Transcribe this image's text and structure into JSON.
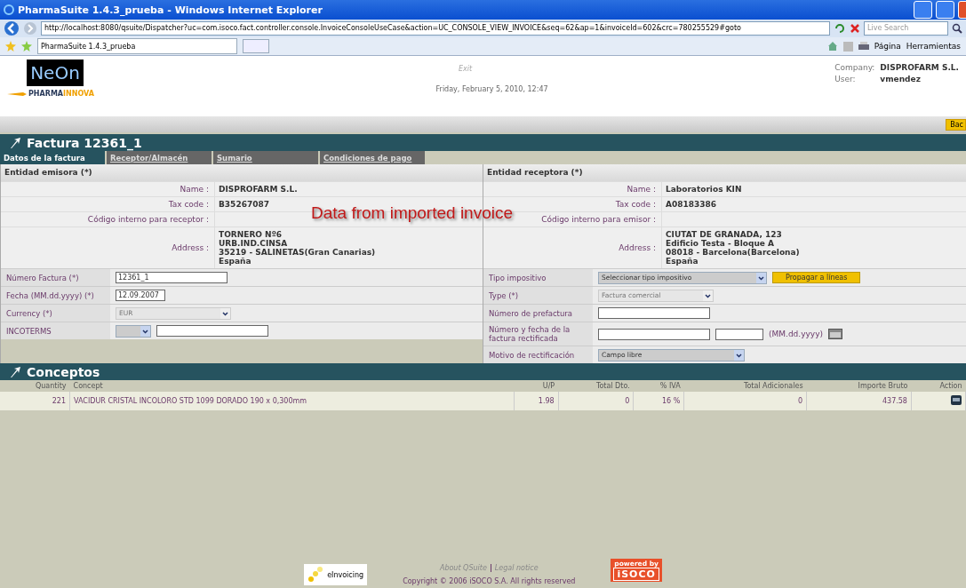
{
  "browser": {
    "title": "PharmaSuite 1.4.3_prueba - Windows Internet Explorer",
    "url": "http://localhost:8080/qsuite/Dispatcher?uc=com.isoco.fact.controller.console.InvoiceConsoleUseCase&action=UC_CONSOLE_VIEW_INVOICE&seq=62&ap=1&invoiceId=602&crc=780255529#goto",
    "search_placeholder": "Live Search",
    "tab": "PharmaSuite 1.4.3_prueba",
    "tools": [
      "Página",
      "Herramientas"
    ]
  },
  "header": {
    "logo": "NeOn",
    "brand": [
      "PHARMA",
      "INNOVA"
    ],
    "exit": "Exit",
    "date": "Friday, February 5, 2010, 12:47",
    "company_label": "Company:",
    "company": "DISPROFARM S.L.",
    "user_label": "User:",
    "user": "vmendez"
  },
  "back_button": "Bac",
  "title": "Factura 12361_1",
  "tabs": [
    {
      "label": "Datos de la factura",
      "selected": true
    },
    {
      "label": "Receptor/Almacén",
      "selected": false
    },
    {
      "label": "Sumario",
      "selected": false
    },
    {
      "label": "Condiciones de pago",
      "selected": false
    }
  ],
  "annotation": "Data from imported invoice",
  "issuer": {
    "heading": "Entidad emisora  (*)",
    "fields": [
      {
        "label": "Name :",
        "value": "DISPROFARM S.L."
      },
      {
        "label": "Tax code :",
        "value": "B35267087"
      },
      {
        "label": "Código interno para receptor :"
      },
      {
        "label": "Address :",
        "lines": [
          "TORNERO Nº6",
          "URB.IND.CINSA",
          "35219 - SALINETAS(Gran Canarias)",
          "España"
        ]
      }
    ]
  },
  "receiver": {
    "heading": "Entidad receptora  (*)",
    "fields": [
      {
        "label": "Name :",
        "value": "Laboratorios KIN"
      },
      {
        "label": "Tax code :",
        "value": "A08183386"
      },
      {
        "label": "Código interno para emisor :"
      },
      {
        "label": "Address :",
        "lines": [
          "CIUTAT DE GRANADA, 123",
          "Edificio Testa - Bloque A",
          "08018 - Barcelona(Barcelona)",
          "España"
        ]
      }
    ]
  },
  "left_form": [
    {
      "label": "Número Factura (*)",
      "kind": "text",
      "value": "12361_1"
    },
    {
      "label": "Fecha (MM.dd.yyyy) (*)",
      "kind": "date",
      "value": "12.09.2007"
    },
    {
      "label": "Currency   (*)",
      "kind": "select",
      "value": "EUR",
      "disabled": true
    },
    {
      "label": "INCOTERMS",
      "kind": "select_text"
    }
  ],
  "right_form": [
    {
      "label": "Tipo impositivo",
      "kind": "select_button",
      "value": "Seleccionar tipo impositivo",
      "button": "Propagar a líneas",
      "disabled": false
    },
    {
      "label": "Type (*)",
      "kind": "select",
      "value": "Factura comercial",
      "disabled": true
    },
    {
      "label": "Número de prefactura",
      "kind": "text"
    },
    {
      "label": "Número y fecha de la factura rectificada",
      "kind": "text_date",
      "hint": "(MM.dd.yyyy)"
    },
    {
      "label": "Motivo de rectificación",
      "kind": "select",
      "value": "Campo libre",
      "disabled": false
    }
  ],
  "section": "Conceptos",
  "table": {
    "columns": [
      "Quantity",
      "Concept",
      "U/P",
      "Total Dto.",
      "% IVA",
      "Total Adicionales",
      "Importe Bruto",
      "Action"
    ],
    "rows": [
      {
        "cells": [
          "221",
          "VACIDUR CRISTAL INCOLORO STD 1099 DORADO 190 x 0,300mm",
          "1.98",
          "0",
          "16 %",
          "0",
          "437.58"
        ]
      }
    ]
  },
  "footer": {
    "einvoicing": "eInvoicing",
    "links": [
      "About QSuite",
      "Legal notice"
    ],
    "copyright": "Copyright © 2006 iSOCO S.A. All rights reserved",
    "powered": [
      "powered by",
      "iSOCO"
    ]
  }
}
